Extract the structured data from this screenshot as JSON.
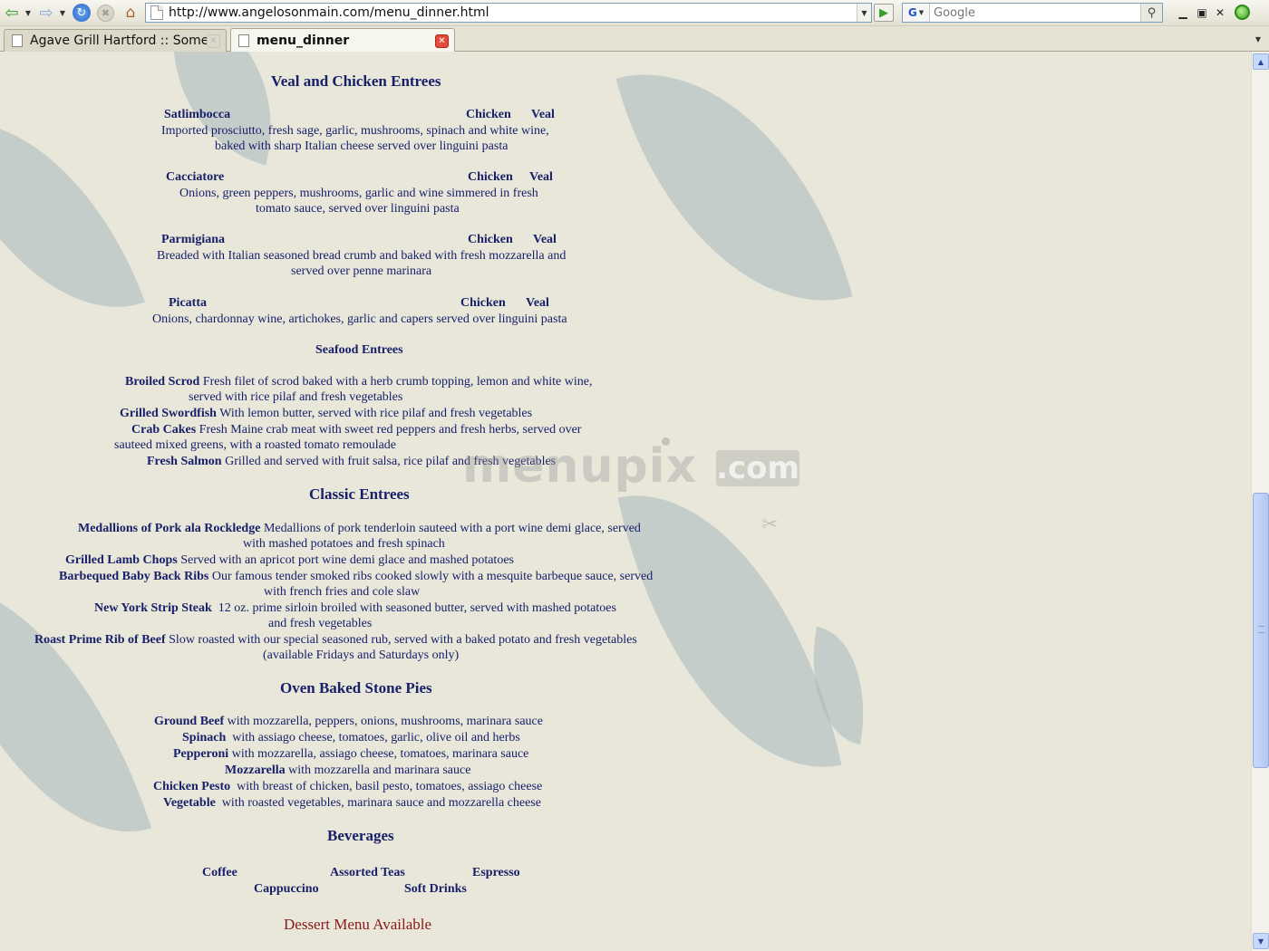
{
  "browser": {
    "url": "http://www.angelosonmain.com/menu_dinner.html",
    "search_placeholder": "Google",
    "search_engine_label": "G",
    "tabs": [
      {
        "label": "Agave Grill Hartford :: Someth...",
        "active": false
      },
      {
        "label": "menu_dinner",
        "active": true
      }
    ],
    "glyphs": {
      "back": "⇦",
      "dropdown": "▼",
      "forward": "⇨",
      "reload": "↻",
      "stop": "✖",
      "home": "⌂",
      "go": "▶",
      "search": "⚲",
      "minimize": "▁",
      "maximize": "▣",
      "close": "✕",
      "tab_close": "✕",
      "scroll_up": "▲",
      "scroll_down": "▼"
    }
  },
  "watermark": {
    "brand": "menupix",
    "suffix": ".com",
    "scissors": "✂"
  },
  "menu": {
    "veal_chicken": {
      "heading": "Veal and Chicken Entrees",
      "items": [
        {
          "name": "Satlimbocca",
          "opt1": "Chicken",
          "opt2": "Veal",
          "desc1": "Imported prosciutto, fresh sage, garlic, mushrooms, spinach and white wine,",
          "desc2": "baked with sharp Italian cheese served over linguini pasta"
        },
        {
          "name": "Cacciatore",
          "opt1": "Chicken",
          "opt2": "Veal",
          "desc1": "Onions, green peppers, mushrooms, garlic and wine simmered in fresh",
          "desc2": "tomato sauce, served over linguini pasta"
        },
        {
          "name": "Parmigiana",
          "opt1": "Chicken",
          "opt2": "Veal",
          "desc1": "Breaded with Italian seasoned bread crumb and baked with fresh mozzarella and",
          "desc2": "served over penne marinara"
        },
        {
          "name": "Picatta",
          "opt1": "Chicken",
          "opt2": "Veal",
          "desc1": "Onions, chardonnay wine, artichokes, garlic and capers served over linguini pasta"
        }
      ]
    },
    "seafood": {
      "heading": "Seafood  Entrees",
      "items": [
        {
          "name": "Broiled Scrod",
          "desc1": "Fresh filet of scrod baked with a herb crumb topping, lemon and white wine,",
          "desc2": "served with rice pilaf and fresh  vegetables"
        },
        {
          "name": "Grilled Swordfish",
          "desc1": "With lemon butter, served with rice pilaf and fresh vegetables"
        },
        {
          "name": "Crab Cakes",
          "desc1": "Fresh Maine crab meat with sweet red peppers and fresh herbs, served over",
          "desc2": "sauteed mixed greens, with a roasted  tomato remoulade"
        },
        {
          "name": "Fresh Salmon",
          "desc1": "Grilled and served with fruit salsa, rice pilaf and fresh vegetables"
        }
      ]
    },
    "classic": {
      "heading": "Classic Entrees",
      "items": [
        {
          "name": "Medallions of Pork ala Rockledge",
          "desc1": "Medallions of pork tenderloin sauteed with a port wine demi glace, served",
          "desc2": "with mashed potatoes and fresh spinach"
        },
        {
          "name": "Grilled Lamb Chops",
          "desc1": "Served with an apricot port wine demi glace and mashed potatoes"
        },
        {
          "name": "Barbequed Baby Back Ribs",
          "desc1": "Our famous tender smoked ribs cooked slowly with a mesquite barbeque sauce, served",
          "desc2": "with french fries and cole slaw"
        },
        {
          "name": "New York Strip Steak",
          "desc1": "12 oz. prime sirloin broiled with seasoned butter, served with mashed potatoes",
          "desc2": "and fresh vegetables"
        },
        {
          "name": "Roast Prime Rib of Beef",
          "desc1": "Slow roasted with our special seasoned rub, served with a baked potato and fresh vegetables",
          "desc2": "(available Fridays and Saturdays only)"
        }
      ]
    },
    "pies": {
      "heading": "Oven Baked Stone Pies",
      "items": [
        {
          "name": "Ground Beef",
          "desc1": "with mozzarella, peppers, onions, mushrooms, marinara sauce"
        },
        {
          "name": "Spinach",
          "desc1": "with assiago cheese, tomatoes, garlic, olive oil and herbs"
        },
        {
          "name": "Pepperoni",
          "desc1": "with mozzarella, assiago cheese, tomatoes, marinara sauce"
        },
        {
          "name": "Mozzarella",
          "desc1": "with mozzarella and marinara sauce"
        },
        {
          "name": "Chicken Pesto",
          "desc1": "with breast of chicken, basil pesto, tomatoes, assiago cheese"
        },
        {
          "name": "Vegetable",
          "desc1": "with roasted vegetables, marinara sauce and mozzarella cheese"
        }
      ]
    },
    "beverages": {
      "heading": "Beverages",
      "items": [
        "Coffee",
        "Assorted Teas",
        "Espresso",
        "Cappuccino",
        "Soft Drinks"
      ]
    },
    "dessert_note": "Dessert Menu Available"
  }
}
